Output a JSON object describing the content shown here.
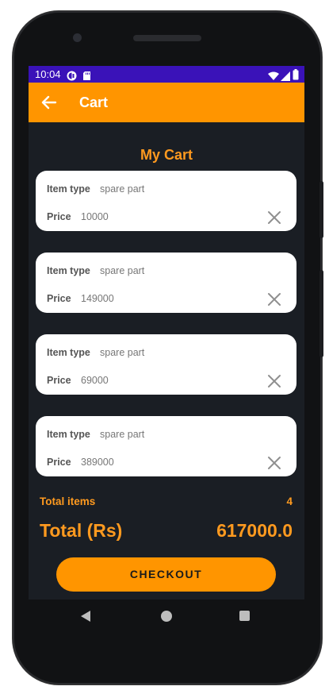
{
  "status_bar": {
    "time": "10:04",
    "left_icons": [
      "app-notification-icon",
      "sd-card-icon"
    ],
    "right_icons": [
      "wifi-icon",
      "signal-icon",
      "battery-icon"
    ]
  },
  "app_bar": {
    "title": "Cart",
    "back_icon": "arrow-left-icon",
    "color": "#ff9500"
  },
  "page": {
    "title": "My Cart",
    "accent_color": "#ff9a1f",
    "background": "#1a1e24"
  },
  "cart_items": [
    {
      "type_label": "Item type",
      "type_value": "spare part",
      "price_label": "Price",
      "price_value": "10000"
    },
    {
      "type_label": "Item type",
      "type_value": "spare part",
      "price_label": "Price",
      "price_value": "149000"
    },
    {
      "type_label": "Item type",
      "type_value": "spare part",
      "price_label": "Price",
      "price_value": "69000"
    },
    {
      "type_label": "Item type",
      "type_value": "spare part",
      "price_label": "Price",
      "price_value": "389000"
    }
  ],
  "summary": {
    "total_items_label": "Total items",
    "total_items_value": "4",
    "total_label": "Total (Rs)",
    "total_value": "617000.0"
  },
  "checkout": {
    "label": "CHECKOUT"
  },
  "nav_bar": {
    "icons": [
      "back-triangle-icon",
      "home-circle-icon",
      "recents-square-icon"
    ]
  }
}
